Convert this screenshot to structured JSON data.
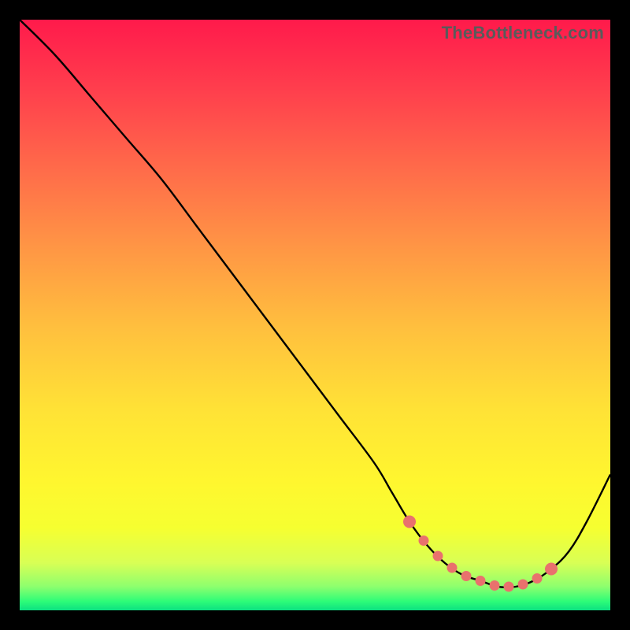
{
  "watermark": "TheBottleneck.com",
  "chart_data": {
    "type": "line",
    "title": "",
    "xlabel": "",
    "ylabel": "",
    "xlim": [
      0,
      100
    ],
    "ylim": [
      0,
      100
    ],
    "series": [
      {
        "name": "bottleneck-curve",
        "x": [
          0,
          6,
          12,
          18,
          24,
          30,
          36,
          42,
          48,
          54,
          60,
          63,
          66,
          69,
          72,
          75,
          78,
          81,
          84,
          87,
          90,
          93,
          96,
          100
        ],
        "y": [
          100,
          94,
          87,
          80,
          73,
          65,
          57,
          49,
          41,
          33,
          25,
          20,
          15,
          11,
          8,
          6,
          5,
          4,
          4,
          5,
          7,
          10,
          15,
          23
        ]
      }
    ],
    "highlight_range_x": [
      66,
      90
    ],
    "colors": {
      "curve": "#000000",
      "highlight_dot": "#e9716d"
    }
  }
}
